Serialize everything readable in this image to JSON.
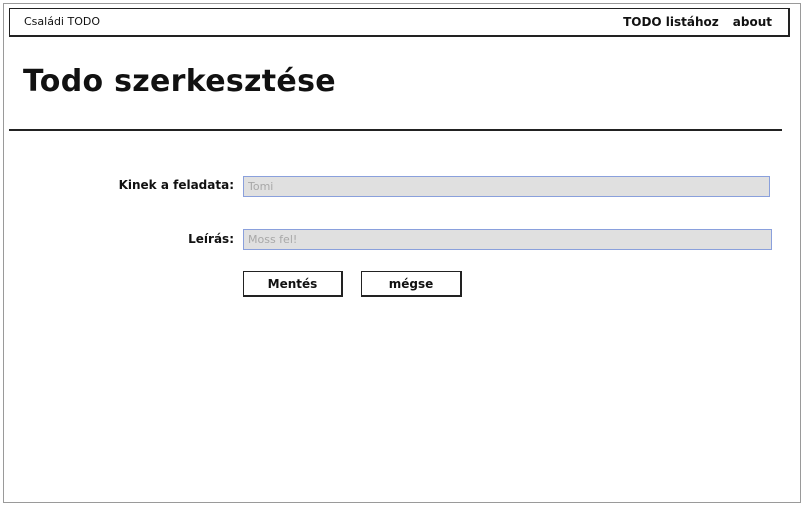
{
  "navbar": {
    "brand": "Családi TODO",
    "links": [
      {
        "label": "TODO listához"
      },
      {
        "label": "about"
      }
    ]
  },
  "page": {
    "title": "Todo szerkesztése"
  },
  "form": {
    "assignee": {
      "label": "Kinek a feladata:",
      "placeholder": "Tomi",
      "value": ""
    },
    "description": {
      "label": "Leírás:",
      "placeholder": "Moss fel!",
      "value": ""
    },
    "save_label": "Mentés",
    "cancel_label": "mégse"
  }
}
